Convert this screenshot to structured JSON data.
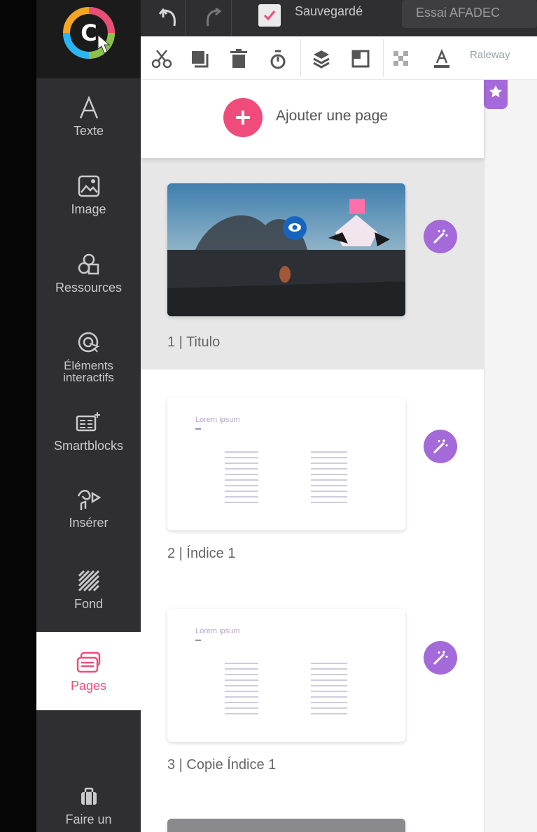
{
  "app": {
    "saved_label": "Sauvegardé",
    "doc_title": "Essai AFADEC"
  },
  "toolbar": {
    "font_name": "Raleway"
  },
  "sidebar": {
    "items": [
      {
        "label": "Texte",
        "icon": "letter-a-icon"
      },
      {
        "label": "Image",
        "icon": "image-icon"
      },
      {
        "label": "Ressources",
        "icon": "shapes-icon"
      },
      {
        "label": "Éléments interactifs",
        "icon": "interactive-cursor-icon"
      },
      {
        "label": "Smartblocks",
        "icon": "smartblock-icon"
      },
      {
        "label": "Insérer",
        "icon": "insert-media-icon"
      },
      {
        "label": "Fond",
        "icon": "background-pattern-icon"
      },
      {
        "label": "Pages",
        "icon": "pages-icon",
        "active": true
      },
      {
        "label": "Faire un",
        "icon": "suitcase-icon"
      }
    ]
  },
  "pages_panel": {
    "add_label": "Ajouter une page",
    "pages": [
      {
        "label": "1 | Titulo",
        "thumb_text": ""
      },
      {
        "label": "2 | Índice 1",
        "thumb_text": "Lorem ipsum"
      },
      {
        "label": "3 | Copie Índice 1",
        "thumb_text": "Lorem ipsum"
      }
    ]
  },
  "colors": {
    "accent_pink": "#ef4c7c",
    "magic_purple": "#a46ad9",
    "sidebar_bg": "#2f2f31"
  }
}
